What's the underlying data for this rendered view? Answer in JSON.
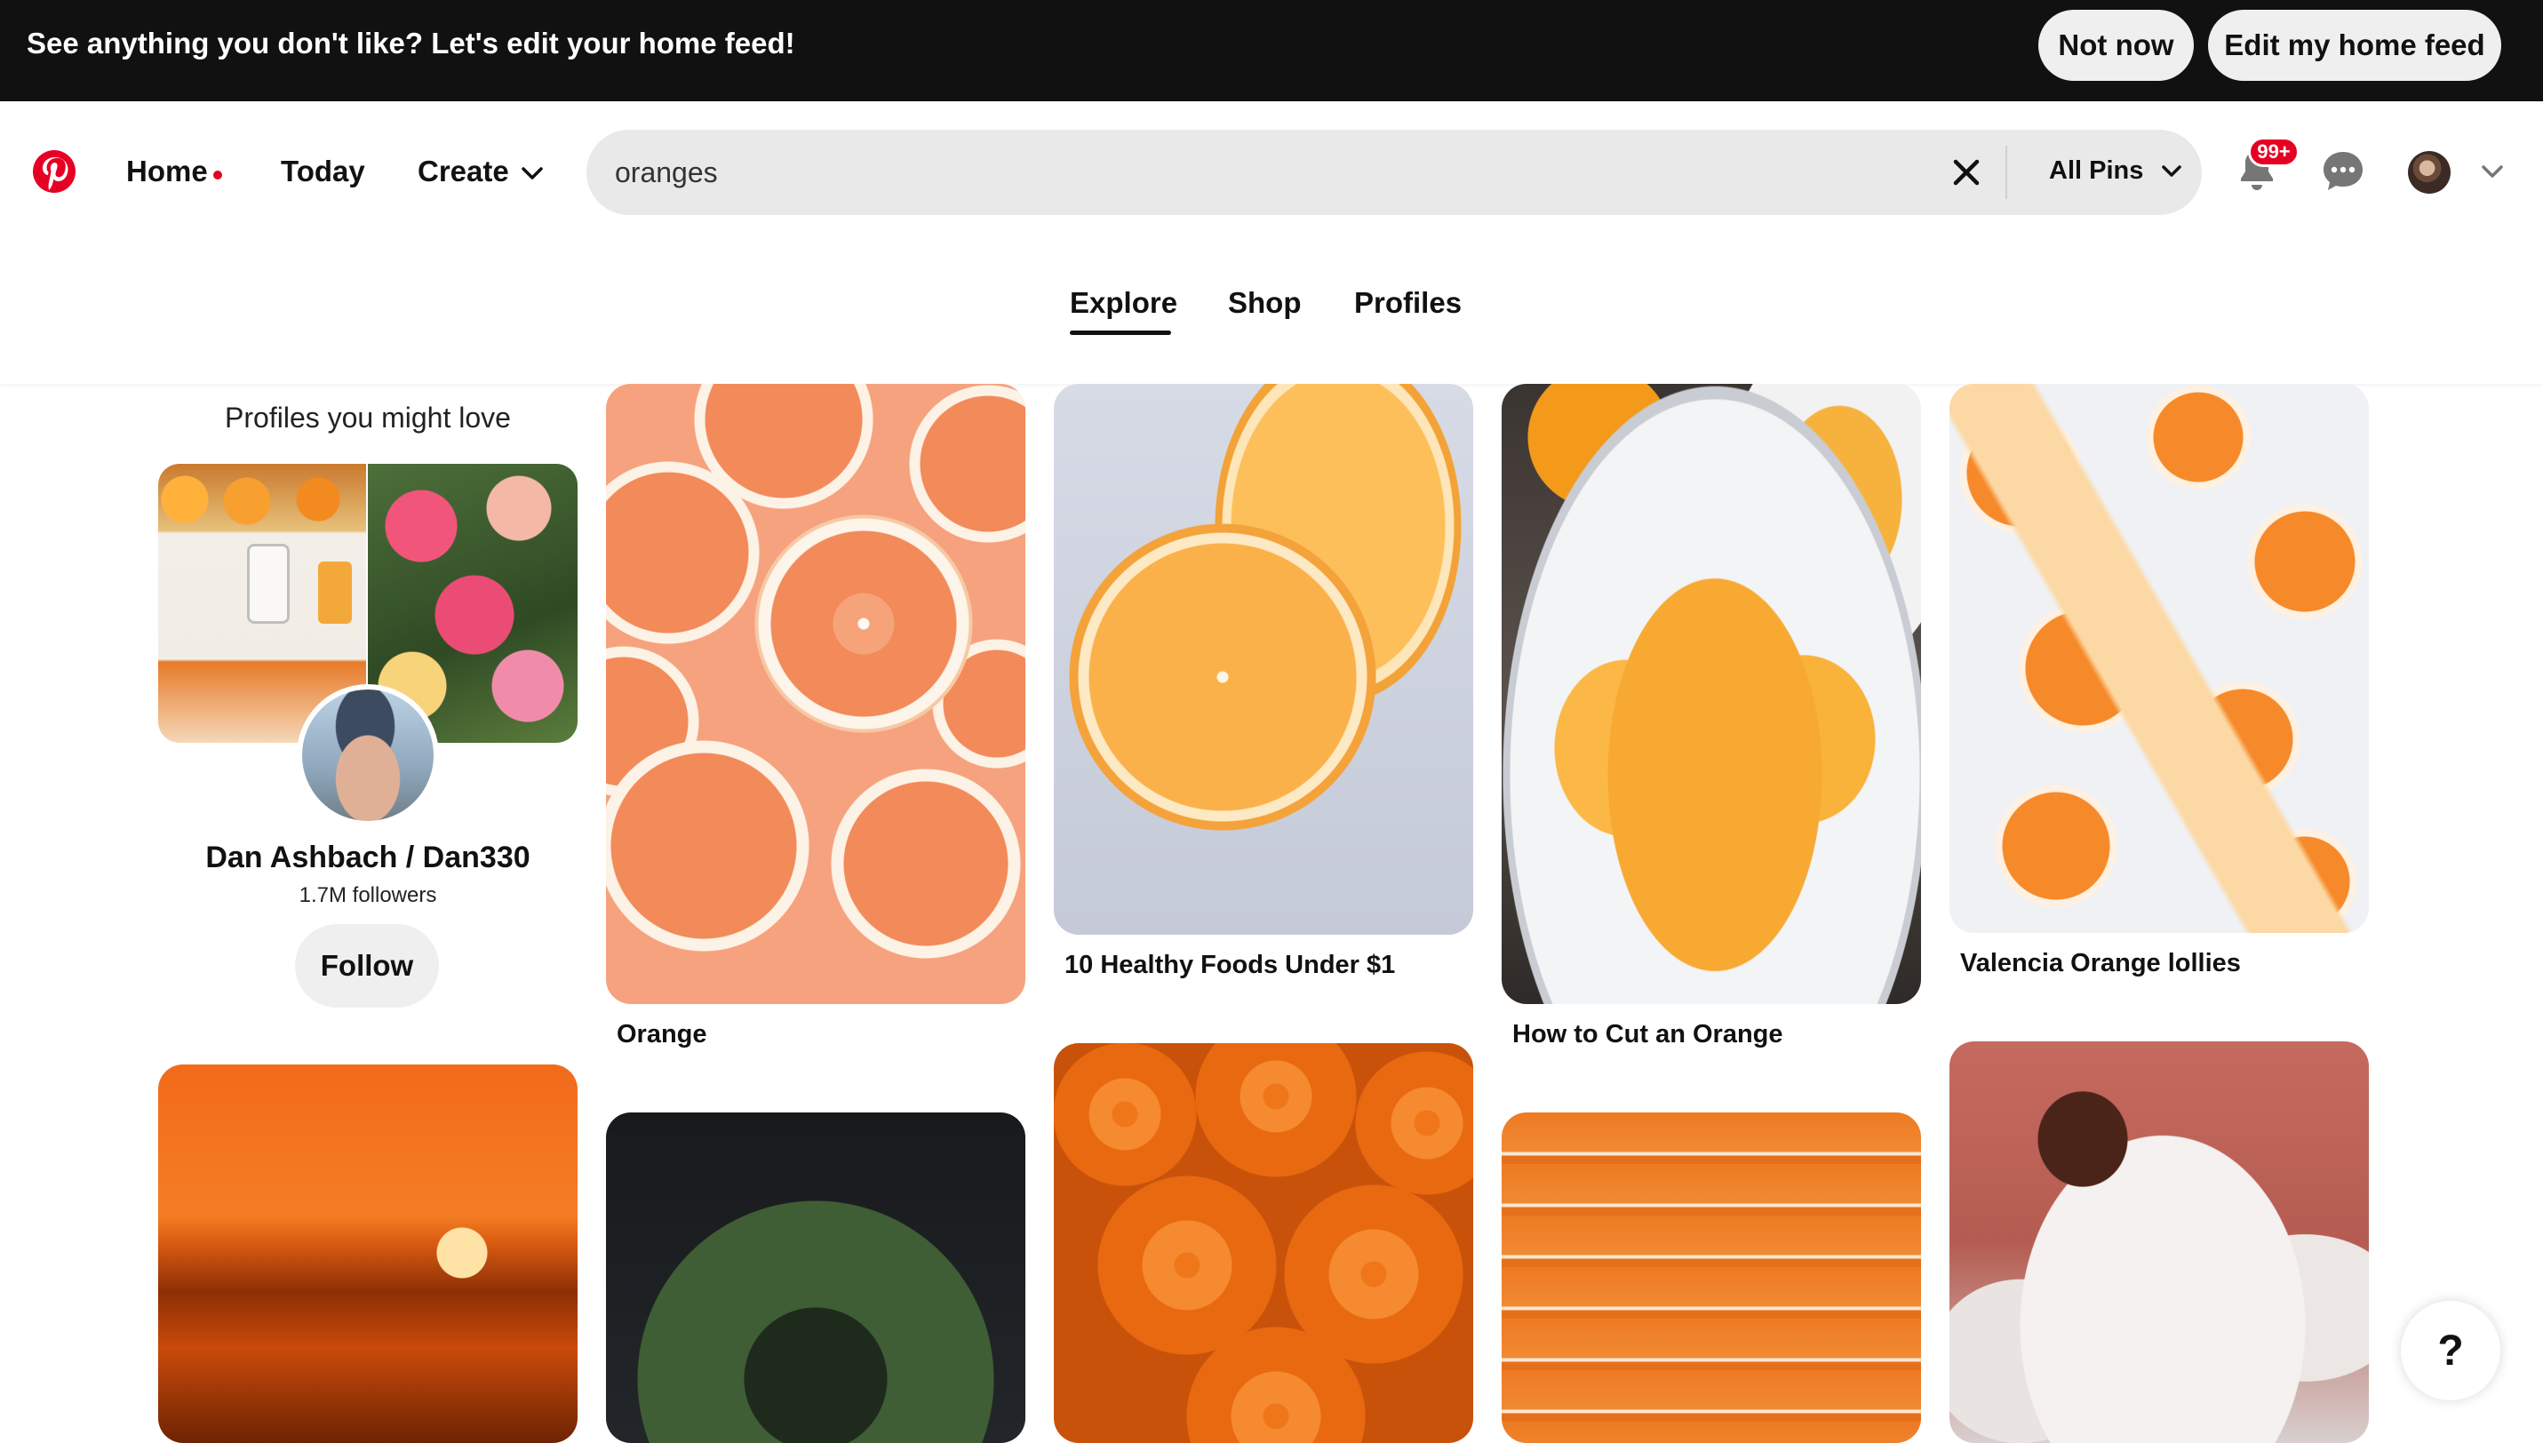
{
  "banner": {
    "message": "See anything you don't like? Let's edit your home feed!",
    "not_now": "Not now",
    "edit": "Edit my home feed"
  },
  "nav": {
    "home": "Home",
    "today": "Today",
    "create": "Create"
  },
  "search": {
    "value": "oranges",
    "filter": "All Pins"
  },
  "notifications": {
    "badge": "99+"
  },
  "tabs": [
    {
      "label": "Explore",
      "active": true
    },
    {
      "label": "Shop",
      "active": false
    },
    {
      "label": "Profiles",
      "active": false
    }
  ],
  "profile_card": {
    "title": "Profiles you might love",
    "name": "Dan Ashbach / Dan330",
    "followers": "1.7M followers",
    "follow": "Follow"
  },
  "pins": [
    {
      "title": "Orange"
    },
    {
      "title": "10 Healthy Foods Under $1"
    },
    {
      "title": "How to Cut an Orange"
    },
    {
      "title": "Valencia Orange lollies"
    }
  ],
  "help": "?",
  "colors": {
    "brand": "#e60023",
    "banner_bg": "#111111",
    "search_bg": "#e9e9e9",
    "button_bg": "#efefef"
  },
  "icons": [
    "pinterest-logo-icon",
    "chevron-down-icon",
    "close-icon",
    "bell-icon",
    "message-icon",
    "help-icon"
  ]
}
